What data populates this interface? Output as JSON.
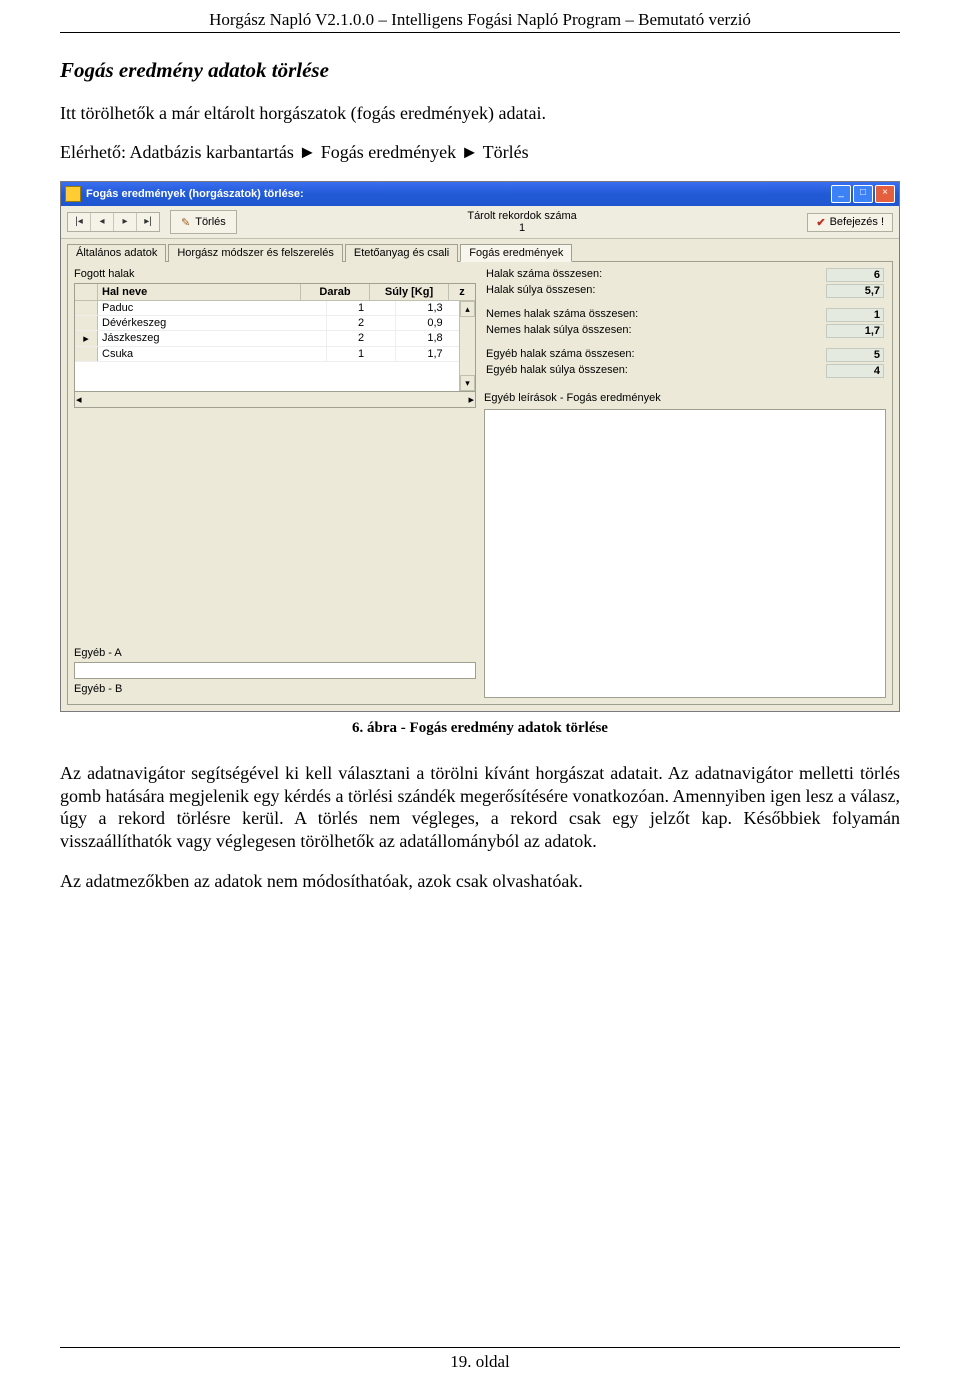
{
  "header": "Horgász Napló V2.1.0.0 – Intelligens Fogási Napló Program – Bemutató verzió",
  "section_title": "Fogás eredmény  adatok törlése",
  "intro": "Itt törölhetők a már eltárolt horgászatok (fogás eredmények) adatai.",
  "path": "Elérhető: Adatbázis karbantartás ► Fogás eredmények ► Törlés",
  "window": {
    "title": "Fogás eredmények (horgászatok) törlése:",
    "toolbar": {
      "delete_label": "Törlés",
      "stored_records_label": "Tárolt rekordok száma",
      "stored_records_count": "1",
      "finish_label": "Befejezés !"
    },
    "tabs": {
      "t1": "Általános adatok",
      "t2": "Horgász módszer és felszerelés",
      "t3": "Etetőanyag és csali",
      "t4": "Fogás eredmények"
    },
    "fish_group_label": "Fogott halak",
    "grid_headers": {
      "name": "Hal neve",
      "db": "Darab",
      "suly": "Súly [Kg]",
      "z": "z"
    },
    "grid_rows": [
      {
        "ind": "",
        "name": "Paduc",
        "db": "1",
        "suly": "1,3"
      },
      {
        "ind": "",
        "name": "Dévérkeszeg",
        "db": "2",
        "suly": "0,9"
      },
      {
        "ind": "▸",
        "name": "Jászkeszeg",
        "db": "2",
        "suly": "1,8"
      },
      {
        "ind": "",
        "name": "Csuka",
        "db": "1",
        "suly": "1,7"
      }
    ],
    "stats": {
      "l1": "Halak száma összesen:",
      "v1": "6",
      "l2": "Halak súlya összesen:",
      "v2": "5,7",
      "l3": "Nemes halak száma összesen:",
      "v3": "1",
      "l4": "Nemes halak súlya összesen:",
      "v4": "1,7",
      "l5": "Egyéb halak száma összesen:",
      "v5": "5",
      "l6": "Egyéb halak súlya összesen:",
      "v6": "4"
    },
    "desc_label": "Egyéb leírások - Fogás eredmények",
    "egyeb_a": "Egyéb - A",
    "egyeb_b": "Egyéb - B"
  },
  "figcaption": "6. ábra - Fogás eredmény adatok törlése",
  "para1": "Az adatnavigátor segítségével ki kell választani a törölni kívánt horgászat adatait. Az adatnavigátor melletti törlés gomb hatására megjelenik egy kérdés a törlési szándék megerősítésére vonatkozóan. Amennyiben igen lesz a válasz, úgy a rekord törlésre kerül. A törlés nem végleges, a rekord csak egy jelzőt kap. Későbbiek folyamán visszaállíthatók vagy véglegesen törölhetők az adatállományból az adatok.",
  "para2": "Az adatmezőkben az adatok nem módosíthatóak, azok csak olvashatóak.",
  "footer": "19. oldal"
}
